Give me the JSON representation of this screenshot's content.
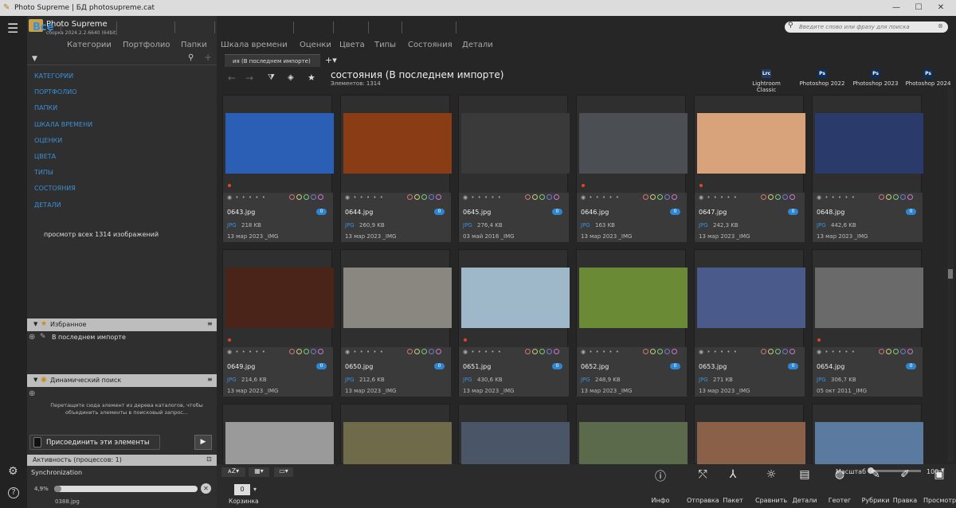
{
  "window": {
    "title": "Photo Supreme | БД photosupreme.cat"
  },
  "app": {
    "name": "Photo Supreme",
    "build": "сборка 2024.2.2.6640 (64bit)"
  },
  "search": {
    "placeholder": "Введите слово или фразу для поиска"
  },
  "nav": {
    "all": "Все",
    "tabs": [
      "Категории",
      "Портфолио",
      "Папки",
      "Шкала времени",
      "Оценки",
      "Цвета",
      "Типы",
      "Состояния",
      "Детали"
    ]
  },
  "sidebar": {
    "links": [
      "КАТЕГОРИИ",
      "ПОРТФОЛИО",
      "ПАПКИ",
      "ШКАЛА ВРЕМЕНИ",
      "ОЦЕНКИ",
      "ЦВЕТА",
      "ТИПЫ",
      "СОСТОЯНИЯ",
      "ДЕТАЛИ"
    ],
    "summary": "просмотр всех 1314 изображений",
    "favorites": {
      "title": "Избранное",
      "item": "В последнем импорте"
    },
    "dynamic": {
      "title": "Динамический поиск",
      "hint": "Перетащите сюда элемент из дерева каталогов, чтобы объединить элементы в поисковый запрос..."
    },
    "join_label": "Присоединить эти элементы",
    "activity": {
      "title": "Активность (процессов: 1)",
      "task": "Synchronization",
      "percent": "4,9%",
      "progress": 0.049,
      "file": "0388.jpg"
    }
  },
  "tab": {
    "label": "ия (В последнем импорте)"
  },
  "content": {
    "title": "состояния (В последнем импорте)",
    "count": "Элементов: 1314"
  },
  "apps": [
    {
      "icon": "Lrc",
      "label": "Lightroom Classic",
      "color": "#1f3b63"
    },
    {
      "icon": "Ps",
      "label": "Photoshop 2022",
      "color": "#0b2f5a"
    },
    {
      "icon": "Ps",
      "label": "Photoshop 2023",
      "color": "#0b2f5a"
    },
    {
      "icon": "Ps",
      "label": "Photoshop 2024",
      "color": "#0b2f5a"
    }
  ],
  "cards": [
    {
      "name": "0643.jpg",
      "fmt": "JPG",
      "size": "218 KB",
      "date": "13 мар 2023 _IMG",
      "badge": "0",
      "color": "#2a5fb5",
      "flag": true
    },
    {
      "name": "0644.jpg",
      "fmt": "JPG",
      "size": "260,9 KB",
      "date": "13 мар 2023 _IMG",
      "badge": "0",
      "color": "#8a3d14",
      "flag": false
    },
    {
      "name": "0645.jpg",
      "fmt": "JPG",
      "size": "276,4 KB",
      "date": "03 май 2016 _IMG",
      "badge": "0",
      "color": "#3a3a3a",
      "flag": false
    },
    {
      "name": "0646.jpg",
      "fmt": "JPG",
      "size": "163 KB",
      "date": "13 мар 2023 _IMG",
      "badge": "0",
      "color": "#4b4e52",
      "flag": true
    },
    {
      "name": "0647.jpg",
      "fmt": "JPG",
      "size": "242,3 KB",
      "date": "13 мар 2023 _IMG",
      "badge": "0",
      "color": "#d8a27a",
      "flag": true
    },
    {
      "name": "0648.jpg",
      "fmt": "JPG",
      "size": "442,6 KB",
      "date": "13 мар 2023 _IMG",
      "badge": "0",
      "color": "#2a3a6a",
      "flag": false
    },
    {
      "name": "0649.jpg",
      "fmt": "JPG",
      "size": "214,6 KB",
      "date": "13 мар 2023 _IMG",
      "badge": "0",
      "color": "#4a2418",
      "flag": true
    },
    {
      "name": "0650.jpg",
      "fmt": "JPG",
      "size": "212,6 KB",
      "date": "13 мар 2023 _IMG",
      "badge": "0",
      "color": "#8a8680",
      "flag": false
    },
    {
      "name": "0651.jpg",
      "fmt": "JPG",
      "size": "430,6 KB",
      "date": "13 мар 2023 _IMG",
      "badge": "0",
      "color": "#9fb8c9",
      "flag": true
    },
    {
      "name": "0652.jpg",
      "fmt": "JPG",
      "size": "248,9 KB",
      "date": "13 мар 2023 _IMG",
      "badge": "0",
      "color": "#6a8a36",
      "flag": false
    },
    {
      "name": "0653.jpg",
      "fmt": "JPG",
      "size": "271 KB",
      "date": "13 мар 2023 _IMG",
      "badge": "0",
      "color": "#4a5a8a",
      "flag": false
    },
    {
      "name": "0654.jpg",
      "fmt": "JPG",
      "size": "306,7 KB",
      "date": "05 окт 2011 _IMG",
      "badge": "0",
      "color": "#6a6a6a",
      "flag": true
    }
  ],
  "row3colors": [
    "#9a9a9a",
    "#6e6a4a",
    "#4a5668",
    "#5a6a4a",
    "#8a6048",
    "#5a7aa0"
  ],
  "scale": {
    "label": "Масштаб",
    "value": "100"
  },
  "basket": {
    "count": "0",
    "label": "Корзинка"
  },
  "actions": [
    "Инфо",
    "Отправка",
    "Пакет",
    "Сравнить",
    "Детали",
    "Геотег",
    "Рубрики",
    "Правка",
    "Просмотр"
  ]
}
